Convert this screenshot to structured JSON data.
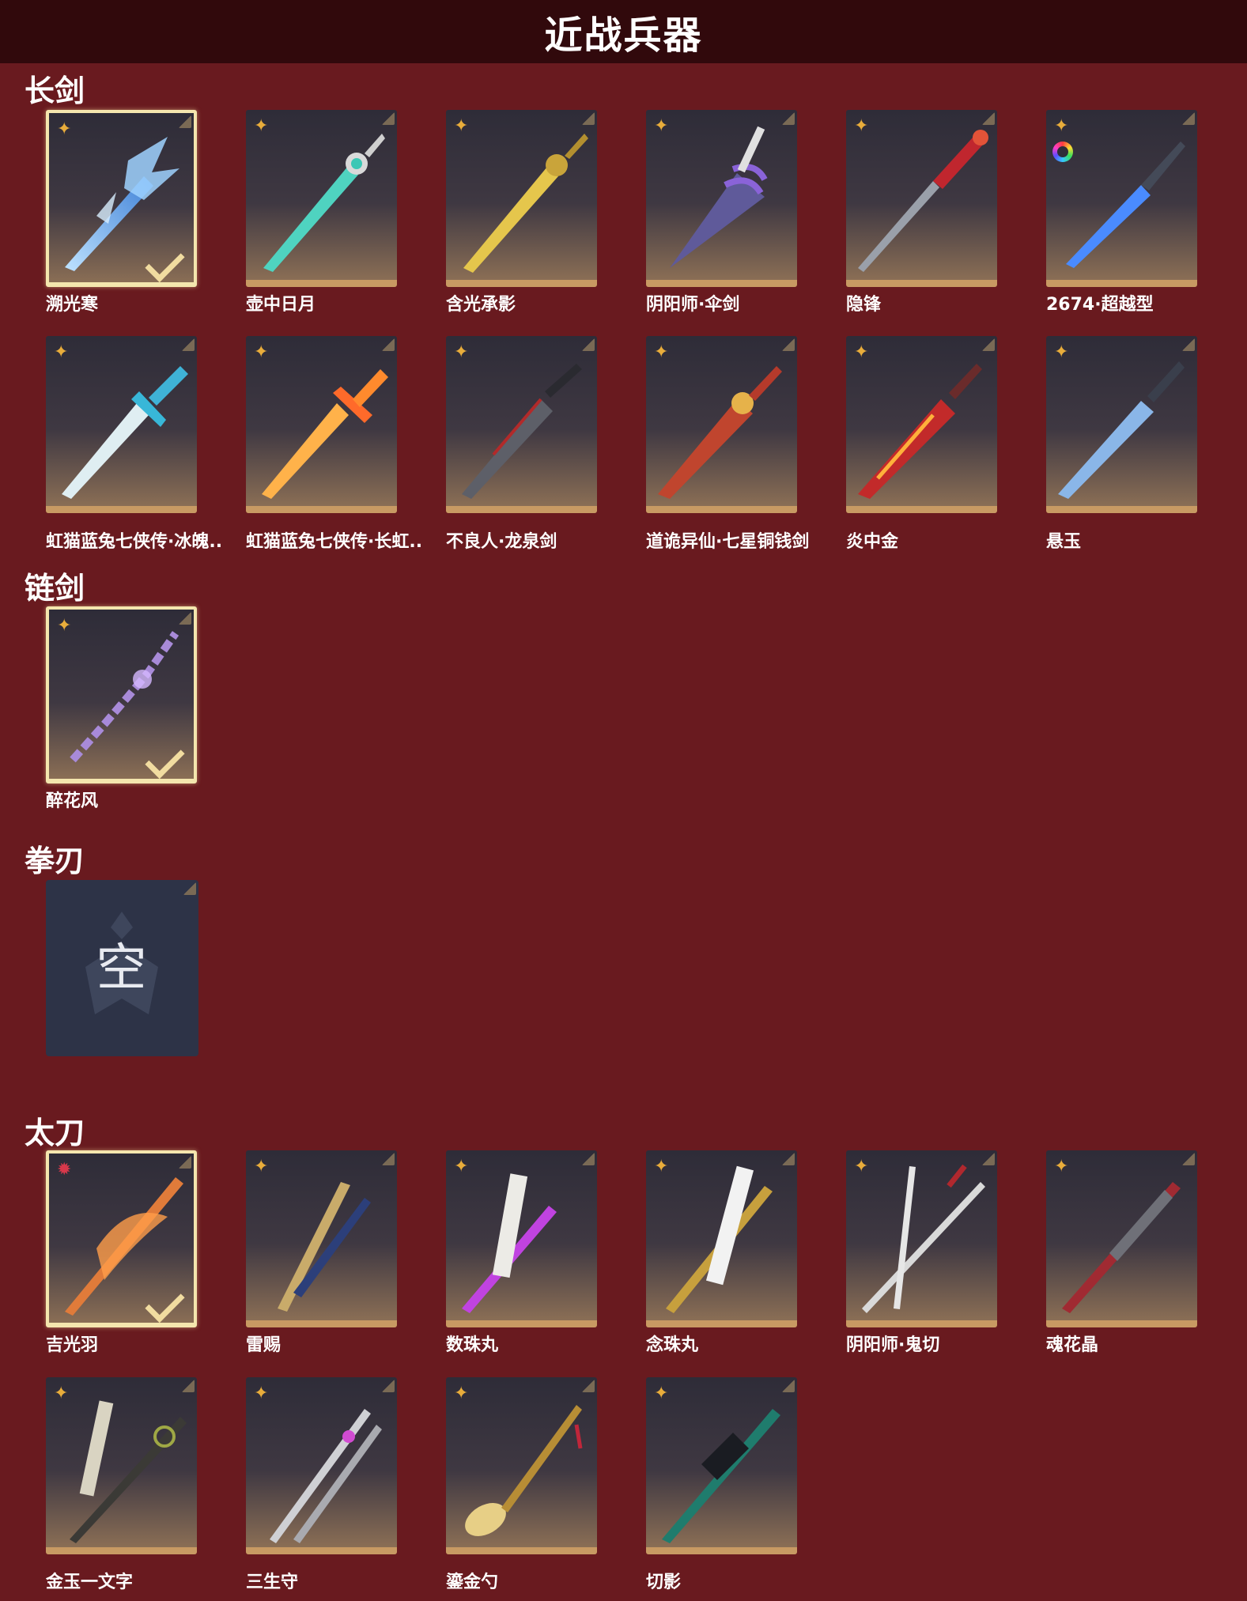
{
  "header": {
    "title": "近战兵器"
  },
  "sections": {
    "longsword": {
      "label": "长剑"
    },
    "chainsword": {
      "label": "链剑"
    },
    "fistblade": {
      "label": "拳刃"
    },
    "katana": {
      "label": "太刀"
    }
  },
  "weapons": {
    "w1": "溯光寒",
    "w2": "壶中日月",
    "w3": "含光承影",
    "w4": "阴阳师·伞剑",
    "w5": "隐锋",
    "w6": "2674·超越型",
    "w7": "虹猫蓝兔七侠传·冰魄..",
    "w8": "虹猫蓝兔七侠传·长虹..",
    "w9": "不良人·龙泉剑",
    "w10": "道诡异仙·七星铜钱剑",
    "w11": "炎中金",
    "w12": "悬玉",
    "w13": "醉花风",
    "w15": "吉光羽",
    "w16": "雷赐",
    "w17": "数珠丸",
    "w18": "念珠丸",
    "w19": "阴阳师·鬼切",
    "w20": "魂花晶",
    "w21": "金玉一文字",
    "w22": "三生守",
    "w23": "鎏金勺",
    "w24": "切影"
  },
  "empty_slot": {
    "glyph": "空"
  },
  "icons": {
    "rarity_gold": "✦",
    "rarity_red": "✹"
  },
  "colors": {
    "background": "#691a1f",
    "title_bar": "#31090c",
    "card_border": "#c89a63",
    "selected_border": "#f4e6ae",
    "rarity_gold": "#e9ad3b",
    "rarity_red": "#d8384b"
  }
}
